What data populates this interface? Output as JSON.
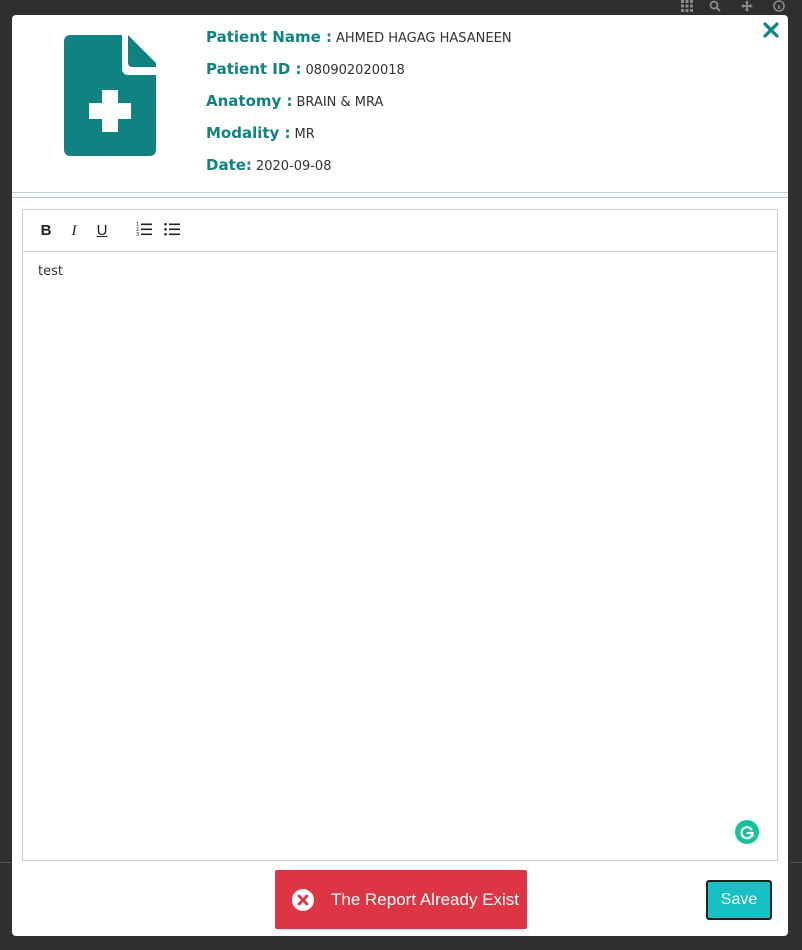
{
  "topbar": {
    "icons": [
      "grid-icon",
      "search-icon",
      "move-icon",
      "info-icon"
    ]
  },
  "patient": {
    "name_label": "Patient Name :",
    "name_value": "AHMED HAGAG HASANEEN",
    "id_label": "Patient ID :",
    "id_value": "080902020018",
    "anatomy_label": "Anatomy :",
    "anatomy_value": "BRAIN & MRA",
    "modality_label": "Modality :",
    "modality_value": "MR",
    "date_label": "Date:",
    "date_value": "2020-09-08"
  },
  "editor": {
    "toolbar": {
      "bold": "B",
      "italic": "I",
      "underline": "U"
    },
    "content": "test"
  },
  "toast": {
    "message": "The Report Already Exist",
    "color": "#de3545"
  },
  "footer": {
    "save_label": "Save"
  },
  "colors": {
    "accent": "#0e8382",
    "save": "#17c0c4",
    "grammarly": "#15c39a"
  }
}
